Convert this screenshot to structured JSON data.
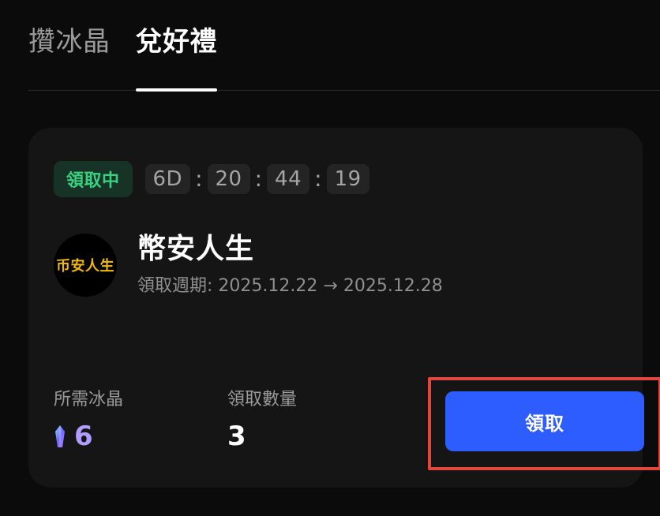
{
  "tabs": {
    "items": [
      {
        "label": "攢冰晶",
        "active": false
      },
      {
        "label": "兌好禮",
        "active": true
      }
    ]
  },
  "card": {
    "status_badge": "領取中",
    "countdown": {
      "days": "6D",
      "hours": "20",
      "minutes": "44",
      "seconds": "19",
      "separator": ":"
    },
    "project": {
      "avatar_text": "币安人生",
      "title": "幣安人生",
      "period_label": "領取週期:",
      "start_date": "2025.12.22",
      "arrow": "→",
      "end_date": "2025.12.28"
    },
    "stats": {
      "required_label": "所需冰晶",
      "required_value": "6",
      "quantity_label": "領取數量",
      "quantity_value": "3"
    },
    "claim_button_label": "領取"
  },
  "colors": {
    "background": "#0b0b0b",
    "card": "#151515",
    "accent_blue": "#2d5cff",
    "status_green": "#39d17f",
    "status_green_bg": "#173327",
    "crystal_purple": "#b39cff",
    "highlight_red": "#e3463c"
  },
  "icons": {
    "crystal": "crystal-icon"
  }
}
